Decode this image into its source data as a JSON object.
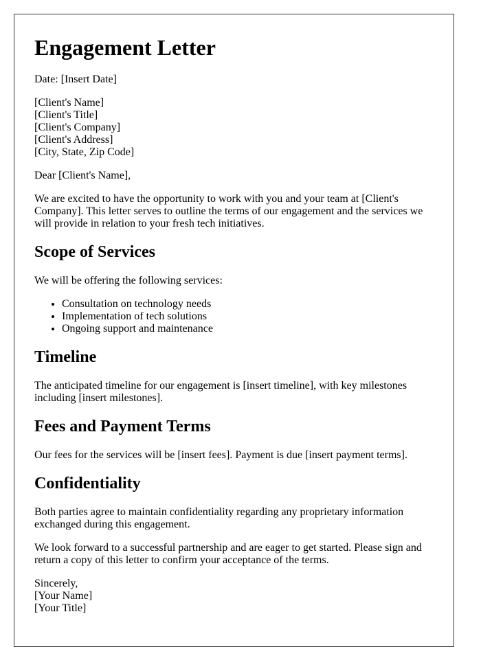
{
  "letter": {
    "title": "Engagement Letter",
    "date_line": "Date: [Insert Date]",
    "recipient": {
      "name": "[Client's Name]",
      "title": "[Client's Title]",
      "company": "[Client's Company]",
      "address": "[Client's Address]",
      "city_state_zip": "[City, State, Zip Code]"
    },
    "salutation": "Dear [Client's Name],",
    "intro": "We are excited to have the opportunity to work with you and your team at [Client's Company]. This letter serves to outline the terms of our engagement and the services we will provide in relation to your fresh tech initiatives.",
    "sections": {
      "scope": {
        "heading": "Scope of Services",
        "lead": "We will be offering the following services:",
        "items": [
          "Consultation on technology needs",
          "Implementation of tech solutions",
          "Ongoing support and maintenance"
        ]
      },
      "timeline": {
        "heading": "Timeline",
        "body": "The anticipated timeline for our engagement is [insert timeline], with key milestones including [insert milestones]."
      },
      "fees": {
        "heading": "Fees and Payment Terms",
        "body": "Our fees for the services will be [insert fees]. Payment is due [insert payment terms]."
      },
      "confidentiality": {
        "heading": "Confidentiality",
        "body": "Both parties agree to maintain confidentiality regarding any proprietary information exchanged during this engagement."
      }
    },
    "closing": "We look forward to a successful partnership and are eager to get started. Please sign and return a copy of this letter to confirm your acceptance of the terms.",
    "signoff": {
      "valediction": "Sincerely,",
      "name": "[Your Name]",
      "title": "[Your Title]"
    }
  }
}
